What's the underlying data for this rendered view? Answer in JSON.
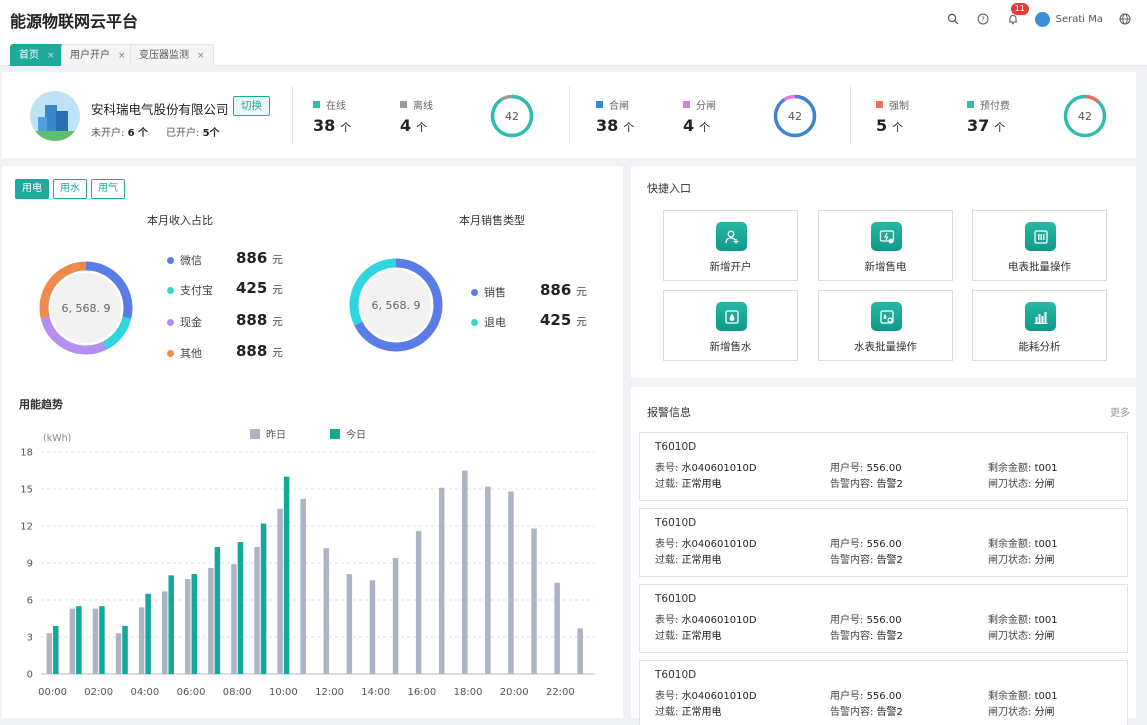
{
  "app": {
    "title": "能源物联网云平台"
  },
  "header": {
    "notification_count": "11",
    "user_name": "Serati Ma"
  },
  "tabs": [
    {
      "label": "首页",
      "close": "×"
    },
    {
      "label": "用户开户",
      "close": "×"
    },
    {
      "label": "变压器监测",
      "close": "×"
    }
  ],
  "company": {
    "name": "安科瑞电气股份有限公司",
    "switch_label": "切换",
    "unopened_label": "未开户:",
    "unopened_value": "6 个",
    "opened_label": "已开户:",
    "opened_value": "5个"
  },
  "stats": [
    {
      "label_a": "在线",
      "value_a": "38",
      "label_b": "离线",
      "value_b": "4",
      "unit": "个",
      "ring_value": "42",
      "color_a": "#2dbcb0",
      "color_b": "#999999",
      "fraction_a": 0.905
    },
    {
      "label_a": "合闸",
      "value_a": "38",
      "label_b": "分闸",
      "value_b": "4",
      "unit": "个",
      "ring_value": "42",
      "color_a": "#3a86d4",
      "color_b": "#e07be0",
      "fraction_a": 0.905
    },
    {
      "label_a": "强制",
      "value_a": "5",
      "label_b": "预付费",
      "value_b": "37",
      "unit": "个",
      "ring_value": "42",
      "color_a": "#e8705f",
      "color_b": "#2dbcb0",
      "fraction_a": 0.119
    }
  ],
  "utility_tabs": [
    "用电",
    "用水",
    "用气"
  ],
  "income": {
    "title": "本月收入占比",
    "center": "6, 568. 9",
    "items": [
      {
        "name": "微信",
        "value": "886",
        "unit": "元",
        "color": "#5b7be6",
        "amount": 886
      },
      {
        "name": "支付宝",
        "value": "425",
        "unit": "元",
        "color": "#2fd6e0",
        "amount": 425
      },
      {
        "name": "现金",
        "value": "888",
        "unit": "元",
        "color": "#b58ef0",
        "amount": 888
      },
      {
        "name": "其他",
        "value": "888",
        "unit": "元",
        "color": "#ee8a4e",
        "amount": 888
      }
    ]
  },
  "sales": {
    "title": "本月销售类型",
    "center": "6, 568. 9",
    "items": [
      {
        "name": "销售",
        "value": "886",
        "unit": "元",
        "color": "#5b7be6",
        "amount": 886
      },
      {
        "name": "退电",
        "value": "425",
        "unit": "元",
        "color": "#2fd6e0",
        "amount": 425
      }
    ]
  },
  "chart_data": {
    "type": "bar",
    "title": "用能趋势",
    "ylabel": "(kWh)",
    "ylim": [
      0,
      18
    ],
    "yticks": [
      0,
      3,
      6,
      9,
      12,
      15,
      18
    ],
    "x_tick_labels": [
      "00:00",
      "02:00",
      "04:00",
      "06:00",
      "08:00",
      "10:00",
      "12:00",
      "14:00",
      "16:00",
      "18:00",
      "20:00",
      "22:00"
    ],
    "grid": true,
    "legend_position": "top-center",
    "categories": [
      0,
      1,
      2,
      3,
      4,
      5,
      6,
      7,
      8,
      9,
      10,
      11,
      12,
      13,
      14,
      15,
      16,
      17,
      18,
      19,
      20,
      21,
      22
    ],
    "series": [
      {
        "name": "昨日",
        "color": "#adb5c4",
        "values": [
          3.3,
          5.3,
          5.3,
          3.3,
          5.4,
          6.7,
          7.7,
          8.6,
          8.9,
          10.3,
          13.4,
          14.2,
          10.2,
          8.1,
          7.6,
          9.4,
          11.6,
          15.1,
          16.5,
          15.2,
          14.8,
          11.8,
          7.4,
          3.7
        ]
      },
      {
        "name": "今日",
        "color": "#13a89a",
        "values": [
          3.9,
          5.5,
          5.5,
          3.9,
          6.5,
          8.0,
          8.1,
          10.3,
          10.7,
          12.2,
          16.0
        ]
      }
    ]
  },
  "quick_entry": {
    "title": "快捷入口",
    "items": [
      {
        "label": "新增开户",
        "icon": "add-user-icon"
      },
      {
        "label": "新增售电",
        "icon": "electric-sale-icon"
      },
      {
        "label": "电表批量操作",
        "icon": "meter-batch-icon"
      },
      {
        "label": "新增售水",
        "icon": "water-sale-icon"
      },
      {
        "label": "水表批量操作",
        "icon": "water-meter-batch-icon"
      },
      {
        "label": "能耗分析",
        "icon": "analysis-icon"
      }
    ]
  },
  "alarms": {
    "title": "报警信息",
    "more_label": "更多",
    "items": [
      {
        "title": "T6010D",
        "meter_label": "表号:",
        "meter": "水040601010D",
        "user_label": "用户号:",
        "user": "556.00",
        "balance_label": "剩余金额:",
        "balance": "t001",
        "overload_label": "过载:",
        "overload": "正常用电",
        "content_label": "告警内容:",
        "content": "告警2",
        "switch_label": "闸刀状态:",
        "switch": "分闸"
      },
      {
        "title": "T6010D",
        "meter_label": "表号:",
        "meter": "水040601010D",
        "user_label": "用户号:",
        "user": "556.00",
        "balance_label": "剩余金额:",
        "balance": "t001",
        "overload_label": "过载:",
        "overload": "正常用电",
        "content_label": "告警内容:",
        "content": "告警2",
        "switch_label": "闸刀状态:",
        "switch": "分闸"
      },
      {
        "title": "T6010D",
        "meter_label": "表号:",
        "meter": "水040601010D",
        "user_label": "用户号:",
        "user": "556.00",
        "balance_label": "剩余金额:",
        "balance": "t001",
        "overload_label": "过载:",
        "overload": "正常用电",
        "content_label": "告警内容:",
        "content": "告警2",
        "switch_label": "闸刀状态:",
        "switch": "分闸"
      },
      {
        "title": "T6010D",
        "meter_label": "表号:",
        "meter": "水040601010D",
        "user_label": "用户号:",
        "user": "556.00",
        "balance_label": "剩余金额:",
        "balance": "t001",
        "overload_label": "过载:",
        "overload": "正常用电",
        "content_label": "告警内容:",
        "content": "告警2",
        "switch_label": "闸刀状态:",
        "switch": "分闸"
      }
    ]
  }
}
